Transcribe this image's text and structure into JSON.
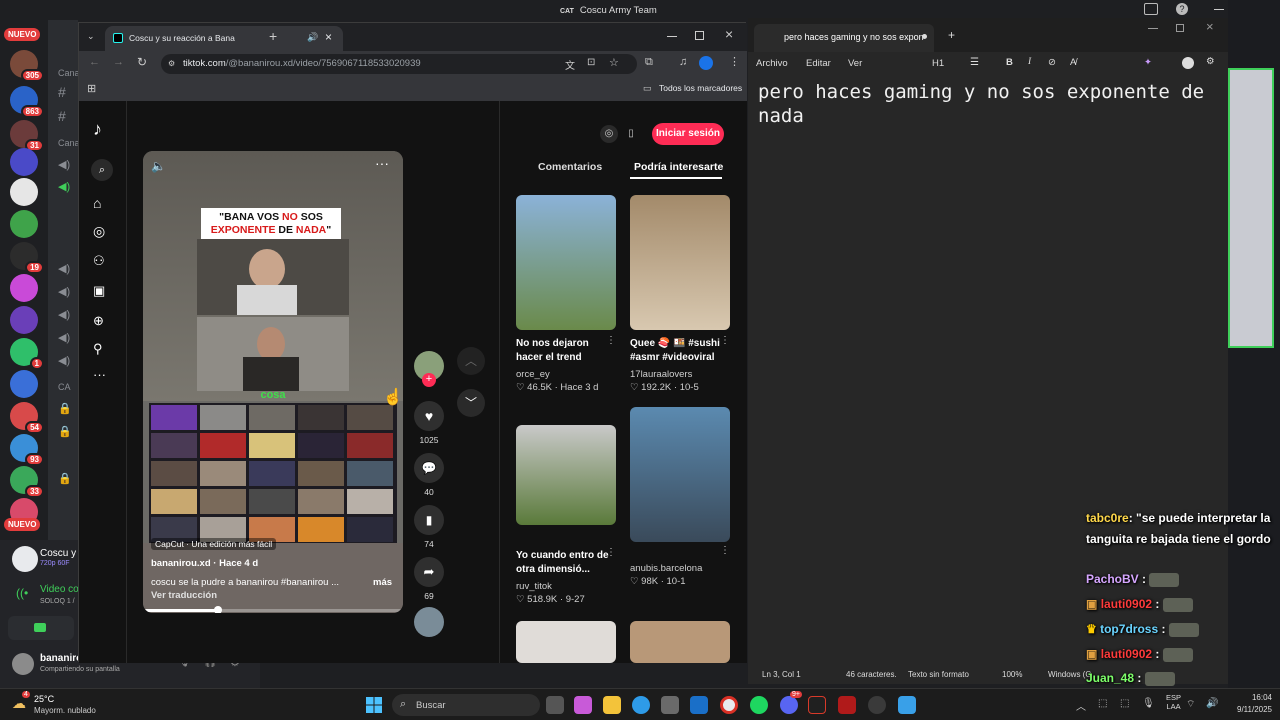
{
  "window_title": "Coscu Army Team",
  "window_title_prefix": "CAT",
  "discord": {
    "nuevo_label": "NUEVO",
    "server_badges": [
      "305",
      "863",
      "31",
      "19",
      "1",
      "54",
      "93",
      "33"
    ],
    "channel_labels": [
      "Cana",
      "Cana",
      "CA"
    ],
    "bottom_tile_title": "Coscu y",
    "bottom_tile_sub": "720p 60F",
    "video_label": "Video co",
    "video_sub": "SOLOQ 1 /",
    "user_name": "bananirou",
    "user_status": "Compartiendo su pantalla"
  },
  "chrome": {
    "tab_title": "Coscu y su reacción a Bana",
    "url_domain": "tiktok.com",
    "url_path": "/@bananirou.xd/video/7569067118533020939",
    "bookmarks_label": "Todos los marcadores",
    "new_tab_icon": "plus"
  },
  "tiktok": {
    "login_button": "Iniciar sesión",
    "tab_comments": "Comentarios",
    "tab_suggested": "Podría interesarte",
    "video": {
      "banner_line1_pre": "\"BANA VOS ",
      "banner_line1_red": "NO",
      "banner_line1_post": " SOS",
      "banner_line2_red": "EXPONENTE",
      "banner_line2_mid": " DE ",
      "banner_line2_red2": "NADA",
      "banner_line2_end": "\"",
      "green_word": "cosa",
      "capcut": "CapCut · Una edición más fácil",
      "author": "bananirou.xd · Hace 4 d",
      "description": "coscu se la pudre a bananirou #bananirou  ...",
      "more": "más",
      "translate": "Ver traducción",
      "progress": 0.29
    },
    "actions": {
      "likes": "1025",
      "comments": "40",
      "saves": "74",
      "shares": "69"
    },
    "suggestions": [
      {
        "caption": "No nos dejaron hacer el trend",
        "author": "orce_ey",
        "stats": "♡ 46.5K · Hace 3 d"
      },
      {
        "caption": "Quee 🍣 🍱 #sushi #asmr #videoviral",
        "author": "17lauraalovers",
        "stats": "♡ 192.2K · 10-5"
      },
      {
        "caption": "Yo cuando entro de otra dimensió...",
        "author": "ruv_titok",
        "stats": "♡ 518.9K · 9-27"
      },
      {
        "caption": "",
        "author": "anubis.barcelona",
        "stats": "♡ 98K · 10-1"
      }
    ]
  },
  "notepad": {
    "tab_title": "pero haces gaming y no sos expon",
    "menu": [
      "Archivo",
      "Editar",
      "Ver"
    ],
    "heading_control": "H1",
    "text_line1": "pero haces gaming y no sos exponente de",
    "text_line2": "nada",
    "status_pos": "Ln 3, Col 1",
    "status_chars": "46 caracteres.",
    "status_format": "Texto sin formato",
    "status_zoom": "100%",
    "status_eol": "Windows (C"
  },
  "chat": [
    {
      "user": "tabc0re",
      "color": "#ffd84a",
      "text": ": \"se puede interpretar la tanguita re bajada tiene el gordo"
    },
    {
      "user": "PachoBV",
      "color": "#d6a6ff",
      "text": ":"
    },
    {
      "user": "lauti0902",
      "color": "#ff3b3b",
      "text": ":"
    },
    {
      "user": "top7dross",
      "color": "#6ad4ff",
      "text": ":"
    },
    {
      "user": "lauti0902",
      "color": "#ff3b3b",
      "text": ":"
    },
    {
      "user": "Juan_48",
      "color": "#7dff6a",
      "text": ":"
    }
  ],
  "taskbar": {
    "weather_temp": "25°C",
    "weather_desc": "Mayorm. nublado",
    "search": "Buscar",
    "lang1": "ESP",
    "lang2": "LAA",
    "time": "16:04",
    "date": "9/11/2025",
    "weather_badge": "4",
    "discord_badge": "9+"
  }
}
